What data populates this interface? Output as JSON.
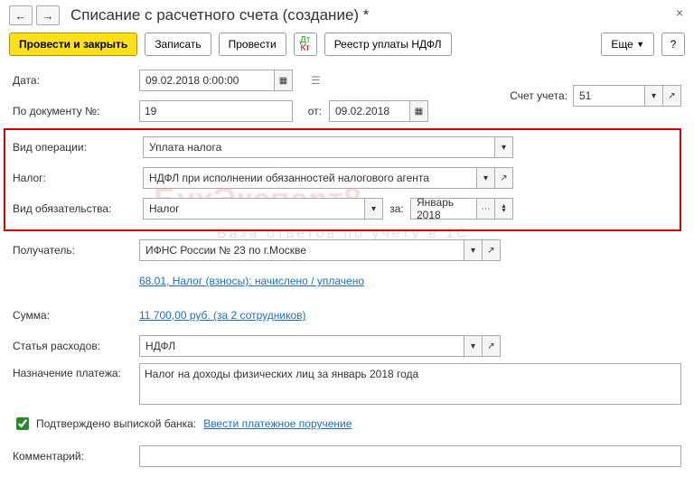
{
  "header": {
    "title": "Списание с расчетного счета (создание) *"
  },
  "toolbar": {
    "post_and_close": "Провести и закрыть",
    "save": "Записать",
    "post": "Провести",
    "ndfl_registry": "Реестр уплаты НДФЛ",
    "more": "Еще",
    "help": "?"
  },
  "labels": {
    "date": "Дата:",
    "doc_no": "По документу №:",
    "from": "от:",
    "account": "Счет учета:",
    "op_type": "Вид операции:",
    "tax": "Налог:",
    "obligation": "Вид обязательства:",
    "for": "за:",
    "recipient": "Получатель:",
    "amount": "Сумма:",
    "expense": "Статья расходов:",
    "purpose": "Назначение платежа:",
    "confirmed": "Подтверждено выпиской банка:",
    "enter_payment": "Ввести платежное поручение",
    "comment": "Комментарий:"
  },
  "values": {
    "date": "09.02.2018  0:00:00",
    "doc_no": "19",
    "doc_from": "09.02.2018",
    "account": "51",
    "op_type": "Уплата налога",
    "tax": "НДФЛ при исполнении обязанностей налогового агента",
    "obligation": "Налог",
    "period": "Январь 2018",
    "recipient": "ИФНС России № 23 по г.Москве",
    "recipient_link": "68.01, Налог (взносы): начислено / уплачено",
    "amount": "11 700,00 руб.  (за 2 сотрудников)",
    "expense": "НДФЛ",
    "purpose": "Налог на доходы физических лиц за январь 2018 года",
    "comment": ""
  },
  "watermark": {
    "main": "БухЭксперт8",
    "sub": "База ответов по учету в 1С"
  }
}
